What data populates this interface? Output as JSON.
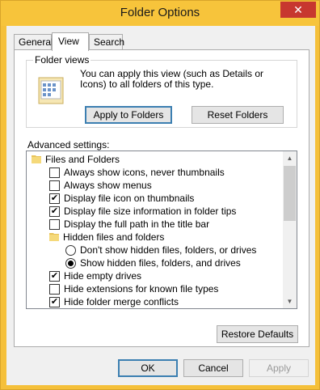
{
  "window": {
    "title": "Folder Options",
    "close_glyph": "✕"
  },
  "tabs": [
    {
      "label": "General"
    },
    {
      "label": "View"
    },
    {
      "label": "Search"
    }
  ],
  "folder_views": {
    "group_title": "Folder views",
    "description": "You can apply this view (such as Details or Icons) to all folders of this type.",
    "apply_button": "Apply to Folders",
    "reset_button": "Reset Folders"
  },
  "advanced": {
    "label": "Advanced settings:",
    "items": [
      {
        "kind": "folder",
        "label": "Files and Folders"
      },
      {
        "kind": "checkbox",
        "label": "Always show icons, never thumbnails",
        "checked": false
      },
      {
        "kind": "checkbox",
        "label": "Always show menus",
        "checked": false
      },
      {
        "kind": "checkbox",
        "label": "Display file icon on thumbnails",
        "checked": true
      },
      {
        "kind": "checkbox",
        "label": "Display file size information in folder tips",
        "checked": true
      },
      {
        "kind": "checkbox",
        "label": "Display the full path in the title bar",
        "checked": false
      },
      {
        "kind": "folder",
        "label": "Hidden files and folders"
      },
      {
        "kind": "radio",
        "label": "Don't show hidden files, folders, or drives",
        "checked": false
      },
      {
        "kind": "radio",
        "label": "Show hidden files, folders, and drives",
        "checked": true
      },
      {
        "kind": "checkbox",
        "label": "Hide empty drives",
        "checked": true
      },
      {
        "kind": "checkbox",
        "label": "Hide extensions for known file types",
        "checked": false
      },
      {
        "kind": "checkbox",
        "label": "Hide folder merge conflicts",
        "checked": true
      }
    ],
    "restore_button": "Restore Defaults"
  },
  "dialog_buttons": {
    "ok": "OK",
    "cancel": "Cancel",
    "apply": "Apply"
  },
  "colors": {
    "accent_titlebar": "#f7c43b",
    "close_button": "#c7372f",
    "default_button_border": "#3c7fb1"
  }
}
